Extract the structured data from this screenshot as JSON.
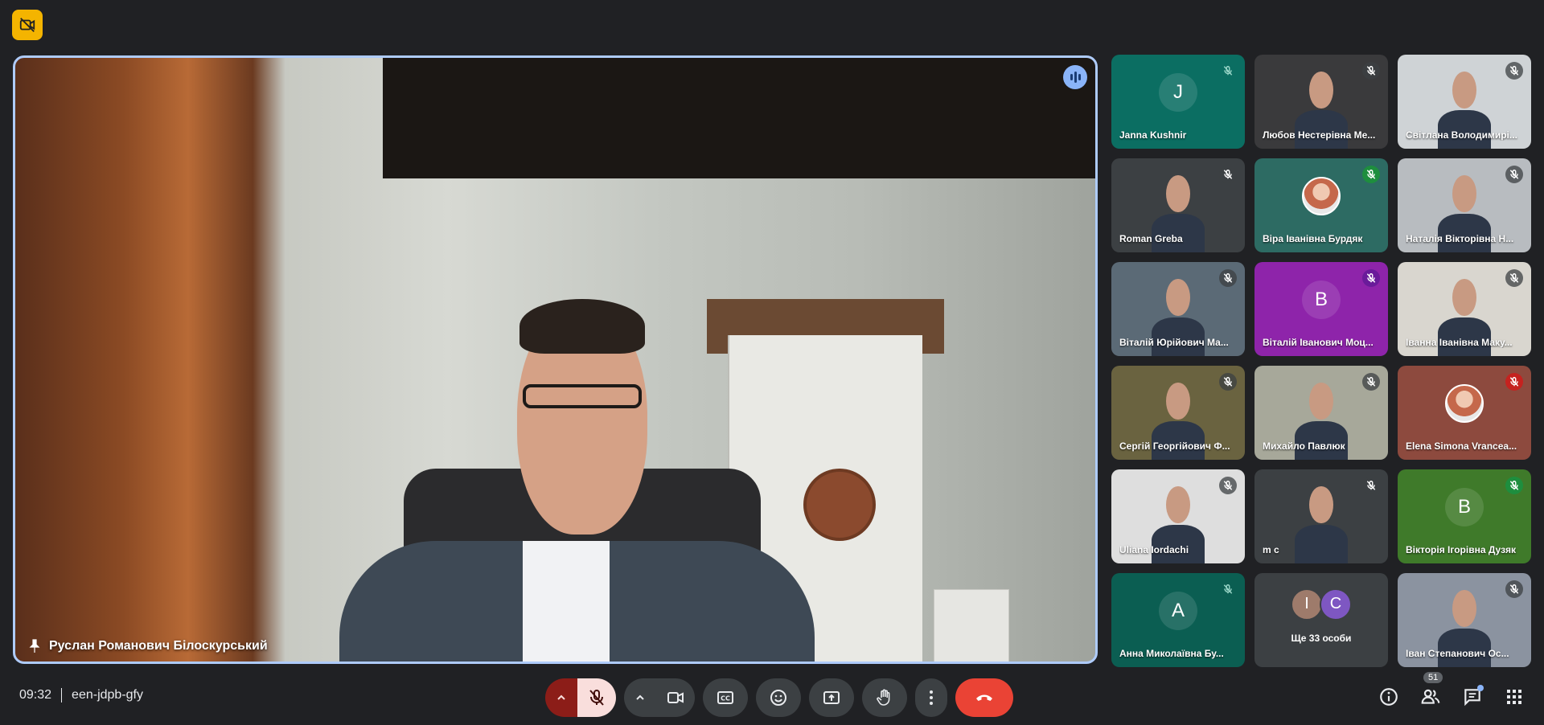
{
  "meeting": {
    "time": "09:32",
    "code": "een-jdpb-gfy"
  },
  "main_speaker": {
    "name": "Руслан Романович Білоскурський"
  },
  "participants": [
    {
      "name": "Janna Kushnir",
      "initial": "J",
      "bg": "#0b6e62",
      "mic": "none",
      "type": "initial"
    },
    {
      "name": "Любов Нестерівна Ме...",
      "bg": "#3a3a3c",
      "mic": "muted",
      "type": "camera"
    },
    {
      "name": "Світлана Володимирі...",
      "bg": "#cfd3d6",
      "mic": "muted",
      "type": "camera"
    },
    {
      "name": "Roman Greba",
      "bg": "#3c4043",
      "mic": "muted",
      "type": "camera"
    },
    {
      "name": "Віра Іванівна Бурдяк",
      "bg": "#2d6b63",
      "mic": "green",
      "type": "photo"
    },
    {
      "name": "Наталія Вікторівна Н...",
      "bg": "#b8bcc0",
      "mic": "muted",
      "type": "camera"
    },
    {
      "name": "Віталій Юрійович Ма...",
      "bg": "#5b6a76",
      "mic": "muted",
      "type": "camera"
    },
    {
      "name": "Віталій Іванович Моц...",
      "initial": "B",
      "bg": "#8e24aa",
      "mic": "purple",
      "type": "initial"
    },
    {
      "name": "Іванна Іванівна Маку...",
      "bg": "#d9d6cf",
      "mic": "muted",
      "type": "camera"
    },
    {
      "name": "Сергій Георгійович Ф...",
      "bg": "#6a6340",
      "mic": "muted",
      "type": "camera"
    },
    {
      "name": "Михайло Павлюк",
      "bg": "#a7a89a",
      "mic": "muted",
      "type": "camera"
    },
    {
      "name": "Elena Simona Vrancea...",
      "bg": "#8d4a3e",
      "mic": "red",
      "type": "photo"
    },
    {
      "name": "Uliana Iordachi",
      "bg": "#dedede",
      "mic": "muted",
      "type": "camera"
    },
    {
      "name": "m c",
      "bg": "#3c4043",
      "mic": "muted",
      "type": "camera"
    },
    {
      "name": "Вікторія Ігорівна Дузяк",
      "initial": "B",
      "bg": "#3f7a2a",
      "mic": "green",
      "type": "initial"
    },
    {
      "name": "Анна Миколаївна Бу...",
      "initial": "A",
      "bg": "#0b5e52",
      "mic": "none",
      "type": "initial"
    },
    {
      "name": "",
      "type": "more"
    },
    {
      "name": "Іван Степанович Ос...",
      "bg": "#8b93a0",
      "mic": "muted",
      "type": "camera"
    }
  ],
  "more": {
    "label": "Ще 33 особи",
    "avatars": [
      {
        "initial": "I",
        "bg": "#9e7b6b"
      },
      {
        "initial": "C",
        "bg": "#7e57c2"
      }
    ]
  },
  "people_count": "51",
  "icons": {
    "recording": "recording-off-icon",
    "mic": "mic-off-icon",
    "camera": "videocam-icon",
    "captions": "closed-captions-icon",
    "reactions": "emoji-icon",
    "present": "present-screen-icon",
    "hand": "raise-hand-icon",
    "more": "more-vert-icon",
    "end": "call-end-icon",
    "info": "info-icon",
    "people": "people-icon",
    "chat": "chat-icon",
    "activities": "apps-grid-icon"
  }
}
